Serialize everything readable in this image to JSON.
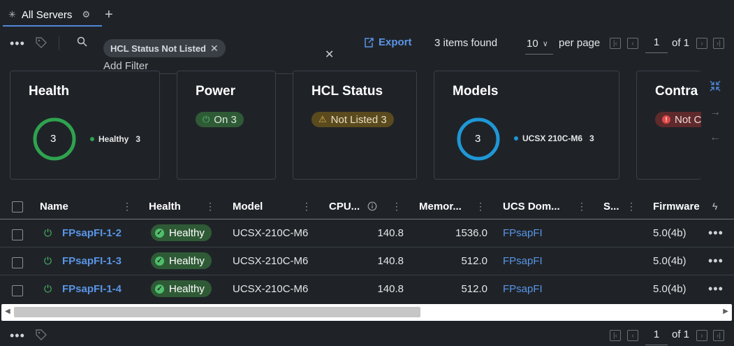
{
  "tab": {
    "label": "All Servers",
    "add_label": "+"
  },
  "toolbar": {
    "more_label": "•••",
    "filter_chip": "HCL Status Not Listed",
    "add_filter": "Add Filter",
    "export_label": "Export",
    "items_found": "3 items found",
    "per_page_value": "10",
    "per_page_label": "per page",
    "page": "1",
    "of_label": "of 1"
  },
  "cards": {
    "health": {
      "title": "Health",
      "count": "3",
      "legend_label": "Healthy",
      "legend_count": "3",
      "color": "#2fa24f"
    },
    "power": {
      "title": "Power",
      "pill": "On 3"
    },
    "hcl": {
      "title": "HCL Status",
      "pill": "Not Listed 3"
    },
    "models": {
      "title": "Models",
      "count": "3",
      "legend_label": "UCSX 210C-M6",
      "legend_count": "3",
      "color": "#1f97d6"
    },
    "contract": {
      "title": "Contra",
      "pill": "Not C"
    }
  },
  "table": {
    "headers": {
      "name": "Name",
      "health": "Health",
      "model": "Model",
      "cpu": "CPU...",
      "memory": "Memor...",
      "ucs_domain": "UCS Dom...",
      "s": "S...",
      "firmware": "Firmware"
    },
    "rows": [
      {
        "name": "FPsapFI-1-2",
        "health": "Healthy",
        "model": "UCSX-210C-M6",
        "cpu": "140.8",
        "memory": "1536.0",
        "ucs_domain": "FPsapFI",
        "firmware": "5.0(4b)"
      },
      {
        "name": "FPsapFI-1-3",
        "health": "Healthy",
        "model": "UCSX-210C-M6",
        "cpu": "140.8",
        "memory": "512.0",
        "ucs_domain": "FPsapFI",
        "firmware": "5.0(4b)"
      },
      {
        "name": "FPsapFI-1-4",
        "health": "Healthy",
        "model": "UCSX-210C-M6",
        "cpu": "140.8",
        "memory": "512.0",
        "ucs_domain": "FPsapFI",
        "firmware": "5.0(4b)"
      }
    ]
  },
  "footer": {
    "page": "1",
    "of_label": "of 1"
  },
  "colors": {
    "accent": "#4f87d8",
    "link": "#5a95e6",
    "healthy": "#4fbf6b",
    "warning_bg": "#5a4a1e",
    "critical": "#e04a4a"
  }
}
